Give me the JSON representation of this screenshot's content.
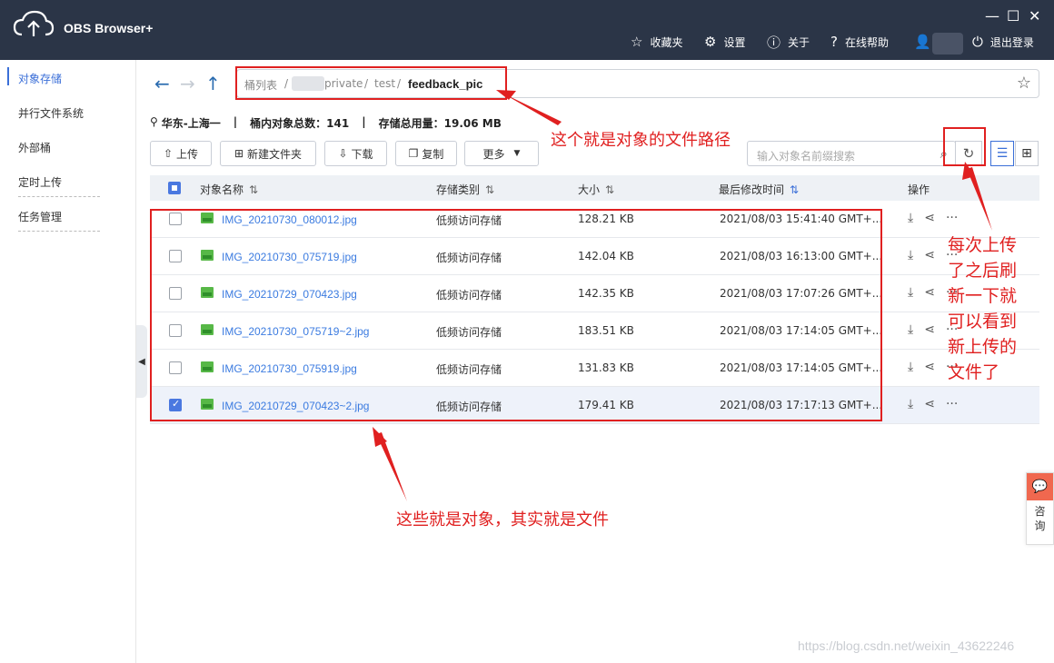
{
  "app": {
    "name": "OBS Browser+"
  },
  "window_controls": {
    "minimize": "—",
    "maximize": "☐",
    "close": "✕"
  },
  "topnav": {
    "favorites": "收藏夹",
    "settings": "设置",
    "about": "关于",
    "help": "在线帮助",
    "logout": "退出登录"
  },
  "sidebar": {
    "items": [
      {
        "label": "对象存储",
        "active": true
      },
      {
        "label": "并行文件系统"
      },
      {
        "label": "外部桶"
      },
      {
        "label": "定时上传"
      },
      {
        "label": "任务管理"
      }
    ]
  },
  "path": {
    "crumbs": [
      "桶列表",
      "/",
      "private",
      "/",
      "test",
      "/"
    ],
    "current": "feedback_pic"
  },
  "info": {
    "region": "华东-上海一",
    "sep": "|",
    "total_label": "桶内对象总数：141",
    "storage_label": "存储总用量：19.06 MB"
  },
  "toolbar": {
    "upload": "上传",
    "new_folder": "新建文件夹",
    "download": "下载",
    "copy": "复制",
    "more": "更多"
  },
  "search": {
    "placeholder": "输入对象名前缀搜索"
  },
  "table": {
    "headers": [
      "对象名称",
      "存储类别",
      "大小",
      "最后修改时间",
      "操作"
    ],
    "rows": [
      {
        "name": "IMG_20210730_080012.jpg",
        "class": "低频访问存储",
        "size": "128.21 KB",
        "mtime": "2021/08/03 15:41:40 GMT+...",
        "checked": false
      },
      {
        "name": "IMG_20210730_075719.jpg",
        "class": "低频访问存储",
        "size": "142.04 KB",
        "mtime": "2021/08/03 16:13:00 GMT+...",
        "checked": false
      },
      {
        "name": "IMG_20210729_070423.jpg",
        "class": "低频访问存储",
        "size": "142.35 KB",
        "mtime": "2021/08/03 17:07:26 GMT+...",
        "checked": false
      },
      {
        "name": "IMG_20210730_075719~2.jpg",
        "class": "低频访问存储",
        "size": "183.51 KB",
        "mtime": "2021/08/03 17:14:05 GMT+...",
        "checked": false
      },
      {
        "name": "IMG_20210730_075919.jpg",
        "class": "低频访问存储",
        "size": "131.83 KB",
        "mtime": "2021/08/03 17:14:05 GMT+...",
        "checked": false
      },
      {
        "name": "IMG_20210729_070423~2.jpg",
        "class": "低频访问存储",
        "size": "179.41 KB",
        "mtime": "2021/08/03 17:17:13 GMT+...",
        "checked": true
      }
    ]
  },
  "annotations": {
    "path_note": "这个就是对象的文件路径",
    "files_note": "这些就是对象，其实就是文件",
    "refresh_note": [
      "每次上传",
      "了之后刷",
      "新一下就",
      "可以看到",
      "新上传的",
      "文件了"
    ]
  },
  "consult": {
    "label1": "咨",
    "label2": "询"
  },
  "watermark": "https://blog.csdn.net/weixin_43622246",
  "colors": {
    "titlebar": "#2b3547",
    "accent": "#3b6fd8",
    "annotation": "#e02020",
    "link": "#3b7be0"
  }
}
